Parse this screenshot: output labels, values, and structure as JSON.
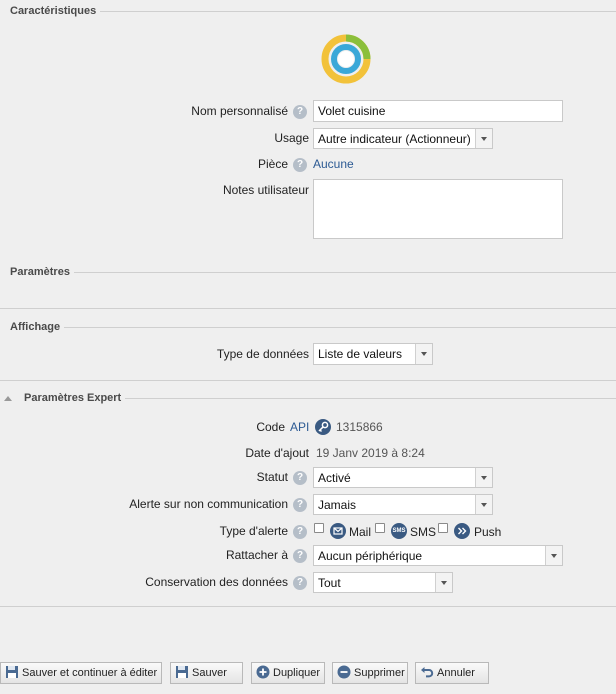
{
  "sections": {
    "caracteristiques": "Caractéristiques",
    "parametres": "Paramètres",
    "affichage": "Affichage",
    "expert": "Paramètres Expert"
  },
  "caracteristiques": {
    "nom_label": "Nom personnalisé",
    "nom_value": "Volet cuisine",
    "usage_label": "Usage",
    "usage_value": "Autre indicateur (Actionneur)",
    "piece_label": "Pièce",
    "piece_value": "Aucune",
    "notes_label": "Notes utilisateur",
    "notes_value": ""
  },
  "affichage": {
    "type_label": "Type de données",
    "type_value": "Liste de valeurs"
  },
  "expert": {
    "code_label": "Code",
    "code_link": "API",
    "code_value": "1315866",
    "date_label": "Date d'ajout",
    "date_value": "19 Janv 2019 à 8:24",
    "statut_label": "Statut",
    "statut_value": "Activé",
    "alerte_label": "Alerte sur non communication",
    "alerte_value": "Jamais",
    "type_alerte_label": "Type d'alerte",
    "alert_options": [
      "Mail",
      "SMS",
      "Push"
    ],
    "rattacher_label": "Rattacher à",
    "rattacher_value": "Aucun périphérique",
    "conservation_label": "Conservation des données",
    "conservation_value": "Tout"
  },
  "icons": {
    "help": "?",
    "sms_badge": "SMS"
  },
  "buttons": {
    "save_continue": "Sauver et continuer à éditer",
    "save": "Sauver",
    "duplicate": "Dupliquer",
    "delete": "Supprimer",
    "cancel": "Annuler"
  },
  "colors": {
    "link": "#2c5a93",
    "ring_blue": "#3aa8d8",
    "ring_yellow": "#f2c23a",
    "ring_green": "#8bbf3b"
  }
}
